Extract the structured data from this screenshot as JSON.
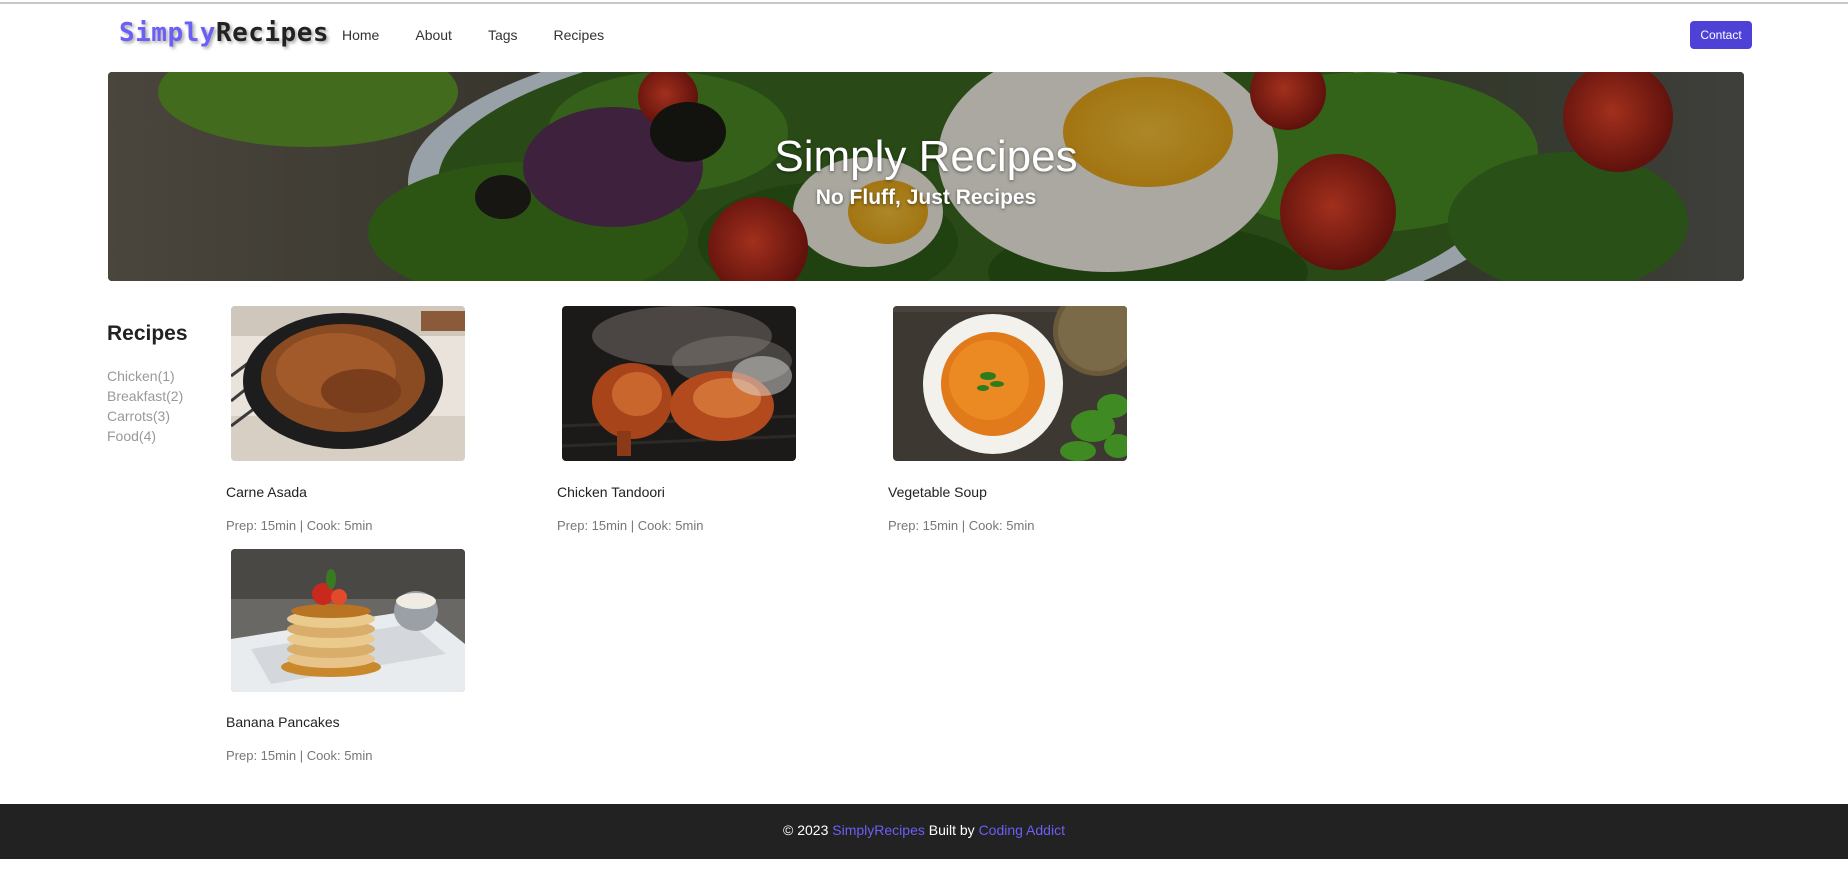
{
  "nav": {
    "logo_part1": "Simply",
    "logo_part2": "Recipes",
    "links": [
      "Home",
      "About",
      "Tags",
      "Recipes"
    ],
    "contact_label": "Contact"
  },
  "hero": {
    "title": "Simply Recipes",
    "subtitle": "No Fluff, Just Recipes"
  },
  "sidebar": {
    "title": "Recipes",
    "tags": [
      "Chicken(1)",
      "Breakfast(2)",
      "Carrots(3)",
      "Food(4)"
    ]
  },
  "recipes": [
    {
      "name": "Carne Asada",
      "meta": "Prep: 15min | Cook: 5min",
      "image": "carne-asada-photo"
    },
    {
      "name": "Chicken Tandoori",
      "meta": "Prep: 15min | Cook: 5min",
      "image": "chicken-tandoori-photo"
    },
    {
      "name": "Vegetable Soup",
      "meta": "Prep: 15min | Cook: 5min",
      "image": "vegetable-soup-photo"
    },
    {
      "name": "Banana Pancakes",
      "meta": "Prep: 15min | Cook: 5min",
      "image": "banana-pancakes-photo"
    }
  ],
  "footer": {
    "copyright": "© 2023",
    "brand": "SimplyRecipes",
    "built_by": "Built by",
    "author": "Coding Addict"
  },
  "colors": {
    "accent": "#6b5ff5",
    "button": "#4d41d6",
    "footer_bg": "#222222"
  }
}
